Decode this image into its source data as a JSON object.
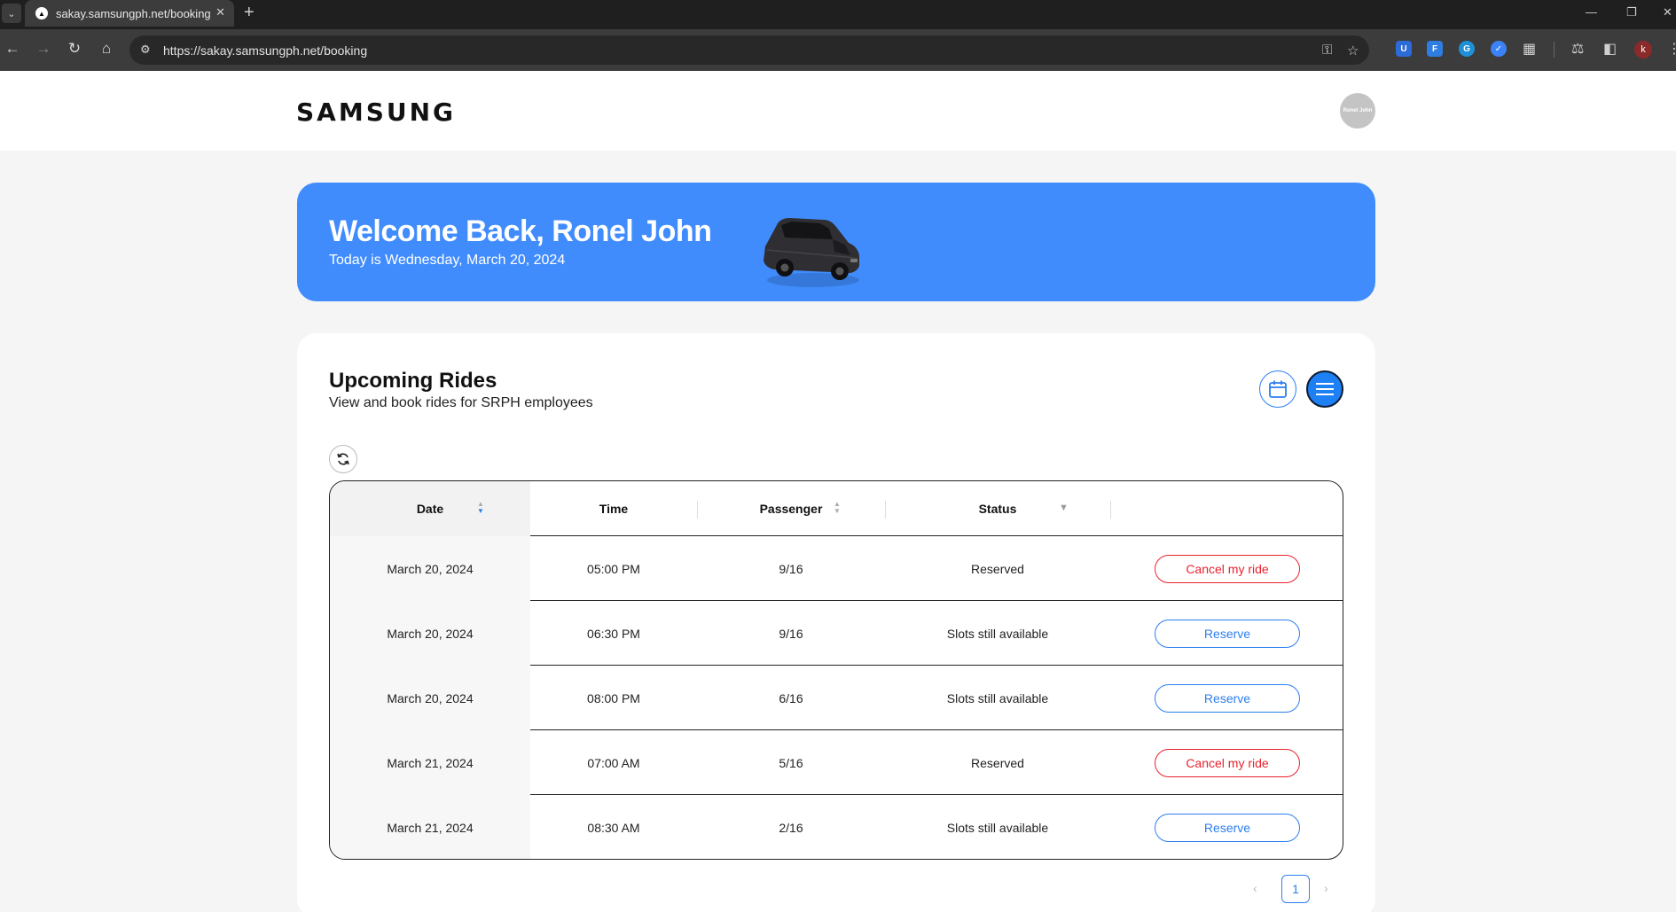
{
  "browser": {
    "tab_title": "sakay.samsungph.net/booking",
    "url": "https://sakay.samsungph.net/booking",
    "profile_initial": "k"
  },
  "header": {
    "logo": "SAMSUNG",
    "avatar_text": "Ronel John"
  },
  "hero": {
    "title": "Welcome Back, Ronel John",
    "subtitle": "Today is Wednesday, March 20, 2024"
  },
  "rides": {
    "title": "Upcoming Rides",
    "subtitle": "View and book rides for SRPH employees",
    "columns": [
      "Date",
      "Time",
      "Passenger",
      "Status"
    ],
    "rows": [
      {
        "date": "March 20, 2024",
        "time": "05:00 PM",
        "passenger": "9/16",
        "status": "Reserved",
        "action": "Cancel my ride"
      },
      {
        "date": "March 20, 2024",
        "time": "06:30 PM",
        "passenger": "9/16",
        "status": "Slots still available",
        "action": "Reserve"
      },
      {
        "date": "March 20, 2024",
        "time": "08:00 PM",
        "passenger": "6/16",
        "status": "Slots still available",
        "action": "Reserve"
      },
      {
        "date": "March 21, 2024",
        "time": "07:00 AM",
        "passenger": "5/16",
        "status": "Reserved",
        "action": "Cancel my ride"
      },
      {
        "date": "March 21, 2024",
        "time": "08:30 AM",
        "passenger": "2/16",
        "status": "Slots still available",
        "action": "Reserve"
      }
    ],
    "pagination": {
      "current_page": "1"
    }
  },
  "colors": {
    "brand_blue": "#418cfc",
    "accent_blue": "#2c7ef0",
    "cancel_red": "#e8222e"
  },
  "icons": {
    "calendar": "calendar-icon",
    "list": "list-icon",
    "refresh": "refresh-icon",
    "sort": "sort-icon",
    "filter": "filter-icon"
  }
}
